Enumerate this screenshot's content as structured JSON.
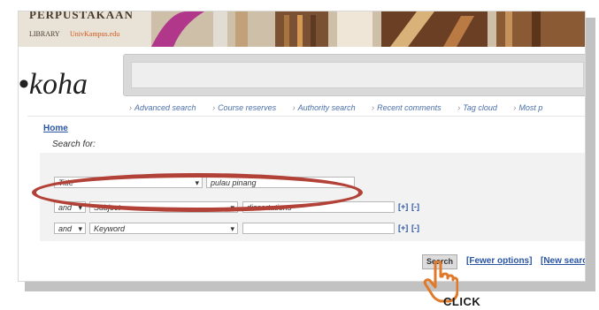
{
  "banner": {
    "library_name": "PERPUSTAKAAN",
    "library_label": "LIBRARY",
    "library_url": "UnivKampus.edu"
  },
  "brand": {
    "logo_text": "koha"
  },
  "nav": {
    "links": [
      "Advanced search",
      "Course reserves",
      "Authority search",
      "Recent comments",
      "Tag cloud",
      "Most p"
    ]
  },
  "page": {
    "breadcrumb": "Home",
    "search_for": "Search for:"
  },
  "rows": [
    {
      "field": "Title",
      "value": "pulau pinang"
    },
    {
      "op": "and",
      "field": "Subject",
      "value": "dissertations",
      "add": "[+]",
      "remove": "[-]"
    },
    {
      "op": "and",
      "field": "Keyword",
      "value": "",
      "add": "[+]",
      "remove": "[-]"
    }
  ],
  "actions": {
    "search_label": "Search",
    "fewer_options": "[Fewer options]",
    "new_search": "[New searc"
  },
  "annotation": {
    "click_label": "CLICK"
  },
  "colors": {
    "highlight": "#b24238",
    "link": "#2a55a5",
    "hand": "#e07a2a"
  }
}
